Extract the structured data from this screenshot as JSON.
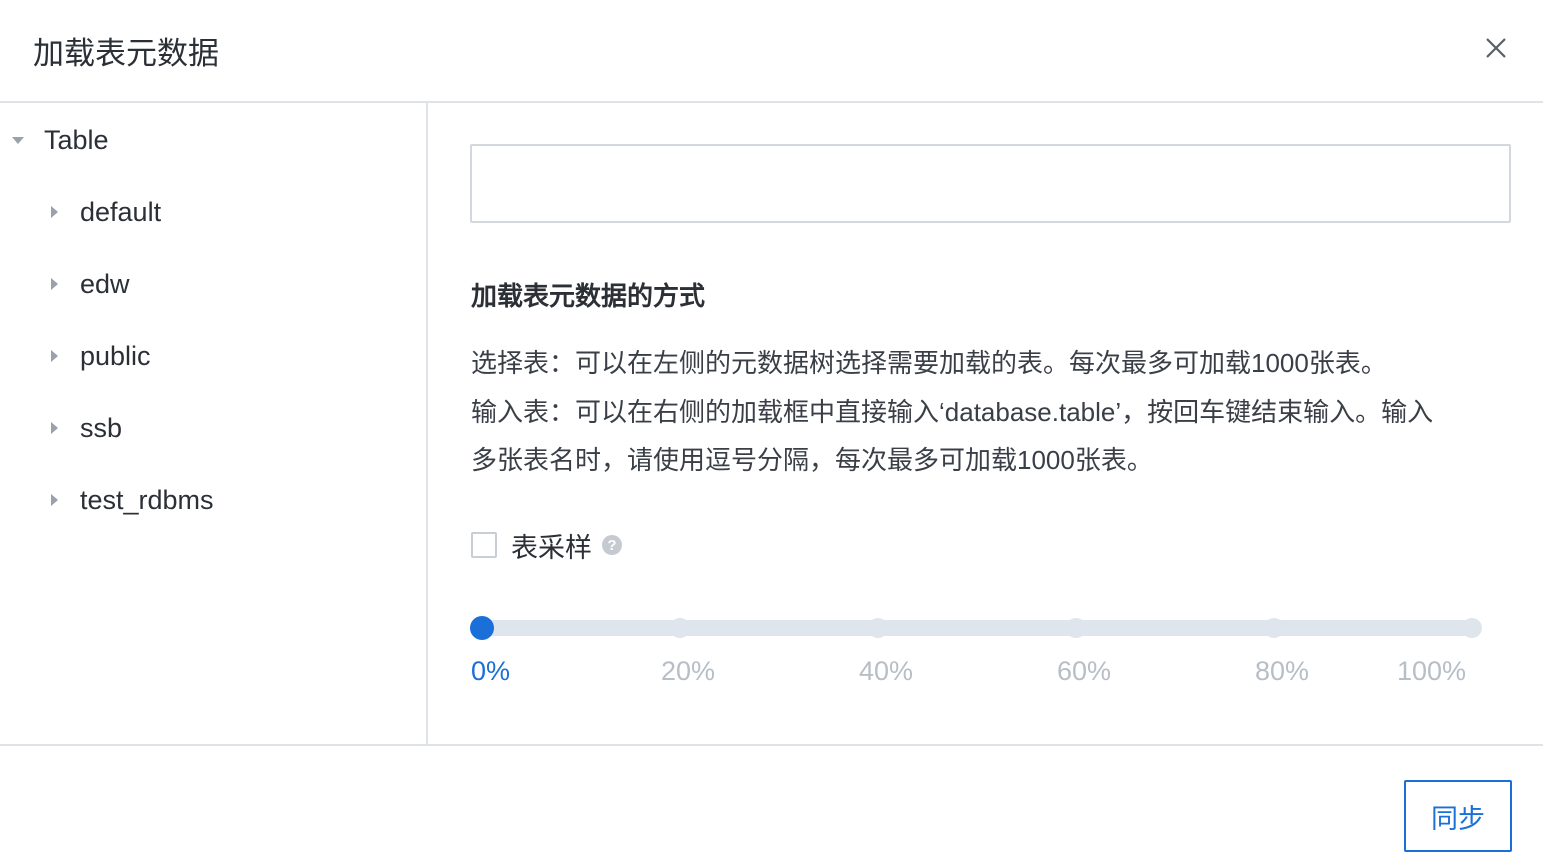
{
  "dialog": {
    "title": "加载表元数据",
    "close_icon": "close-icon"
  },
  "tree": {
    "root": {
      "label": "Table",
      "expanded": true,
      "icon": "caret-down-icon"
    },
    "children": [
      {
        "label": "default",
        "icon": "caret-right-icon"
      },
      {
        "label": "edw",
        "icon": "caret-right-icon"
      },
      {
        "label": "public",
        "icon": "caret-right-icon"
      },
      {
        "label": "ssb",
        "icon": "caret-right-icon"
      },
      {
        "label": "test_rdbms",
        "icon": "caret-right-icon"
      }
    ]
  },
  "content": {
    "input": {
      "value": "",
      "placeholder": ""
    },
    "section_title": "加载表元数据的方式",
    "description": [
      "选择表：可以在左侧的元数据树选择需要加载的表。每次最多可加载1000张表。",
      "输入表：可以在右侧的加载框中直接输入‘database.table’，按回车键结束输入。输入",
      "多张表名时，请使用逗号分隔，每次最多可加载1000张表。"
    ],
    "sample": {
      "label": "表采样",
      "checked": false,
      "help_icon": "question-circle-icon",
      "help_glyph": "?"
    },
    "slider": {
      "value": 0,
      "marks": [
        "0%",
        "20%",
        "40%",
        "60%",
        "80%",
        "100%"
      ],
      "accent": "#1b6fd8",
      "track_color": "#dfe5ec"
    }
  },
  "footer": {
    "sync_label": "同步"
  }
}
